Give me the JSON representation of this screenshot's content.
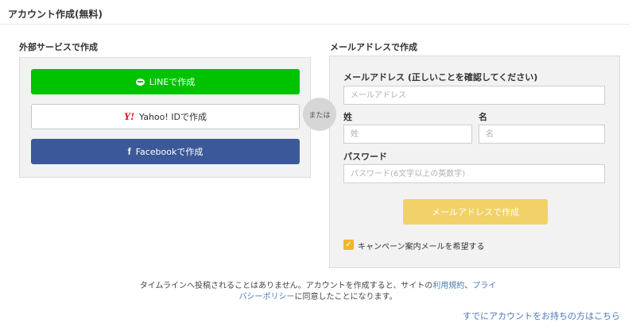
{
  "page": {
    "title": "アカウント作成(無料)"
  },
  "external": {
    "section_label": "外部サービスで作成",
    "line_label": "LINEで作成",
    "yahoo_label": "Yahoo! IDで作成",
    "facebook_label": "Facebookで作成",
    "or_label": "または"
  },
  "email_form": {
    "section_label": "メールアドレスで作成",
    "email_label": "メールアドレス (正しいことを確認してください)",
    "email_placeholder": "メールアドレス",
    "email_value": "",
    "sei_label": "姓",
    "sei_placeholder": "姓",
    "mei_label": "名",
    "mei_placeholder": "名",
    "password_label": "パスワード",
    "password_placeholder": "パスワード(6文字以上の英数字)",
    "submit_label": "メールアドレスで作成",
    "campaign_checked": true,
    "campaign_label": "キャンペーン案内メールを希望する"
  },
  "terms": {
    "text_before": "タイムラインへ投稿されることはありません。アカウントを作成すると、サイトの",
    "terms_link": "利用規約",
    "separator": "、",
    "privacy_link_part1": "プライ",
    "privacy_link_part2": "バシーポリシー",
    "text_after": "に同意したことになります。"
  },
  "login_link": "すでにアカウントをお持ちの方はこちら",
  "colors": {
    "line": "#00c300",
    "facebook": "#3b5998",
    "yahoo_red": "#e60012",
    "submit": "#f2d168",
    "checkbox": "#f0b62c",
    "link": "#4a79b5"
  },
  "icons": {
    "line": "line-icon",
    "yahoo": "yahoo-icon",
    "facebook": "facebook-icon"
  }
}
